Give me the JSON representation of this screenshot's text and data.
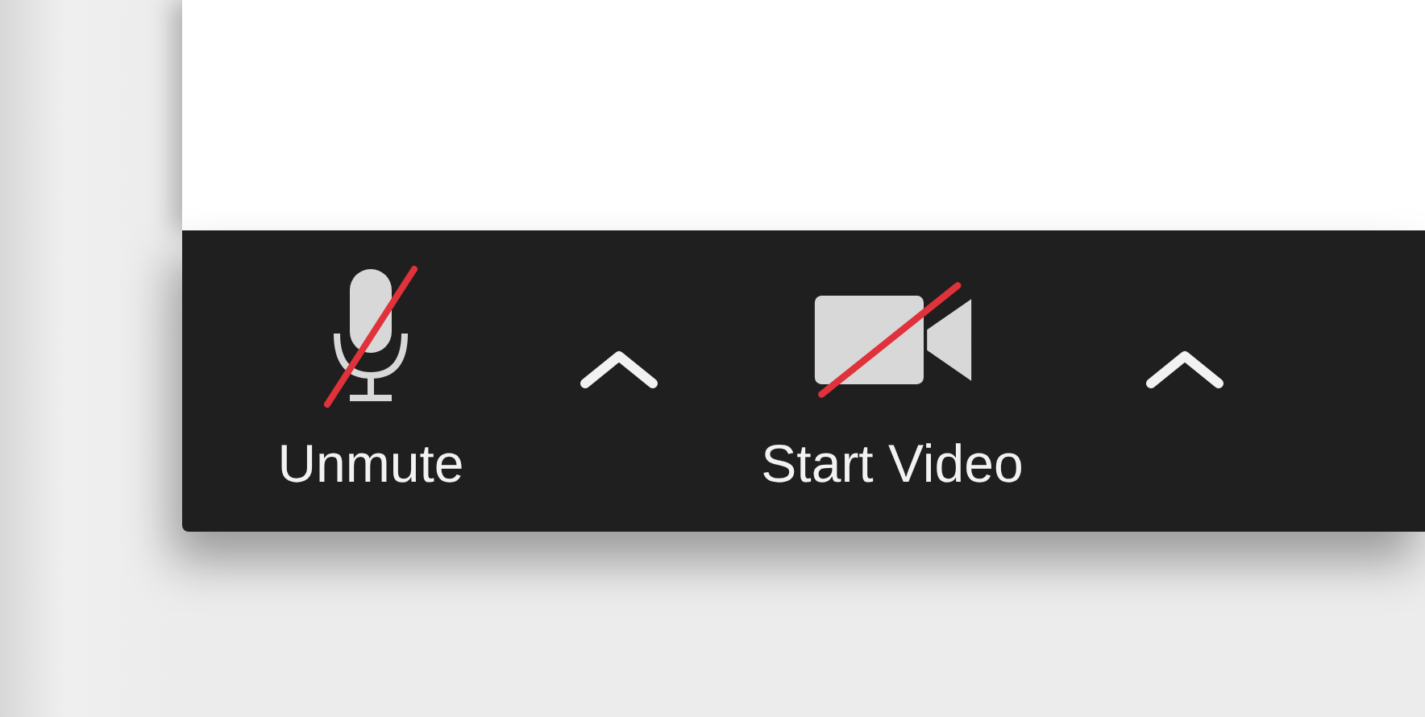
{
  "toolbar": {
    "buttons": [
      {
        "kind": "audio",
        "label": "Unmute",
        "muted": true
      },
      {
        "kind": "video",
        "label": "Start Video",
        "muted": true
      }
    ]
  }
}
